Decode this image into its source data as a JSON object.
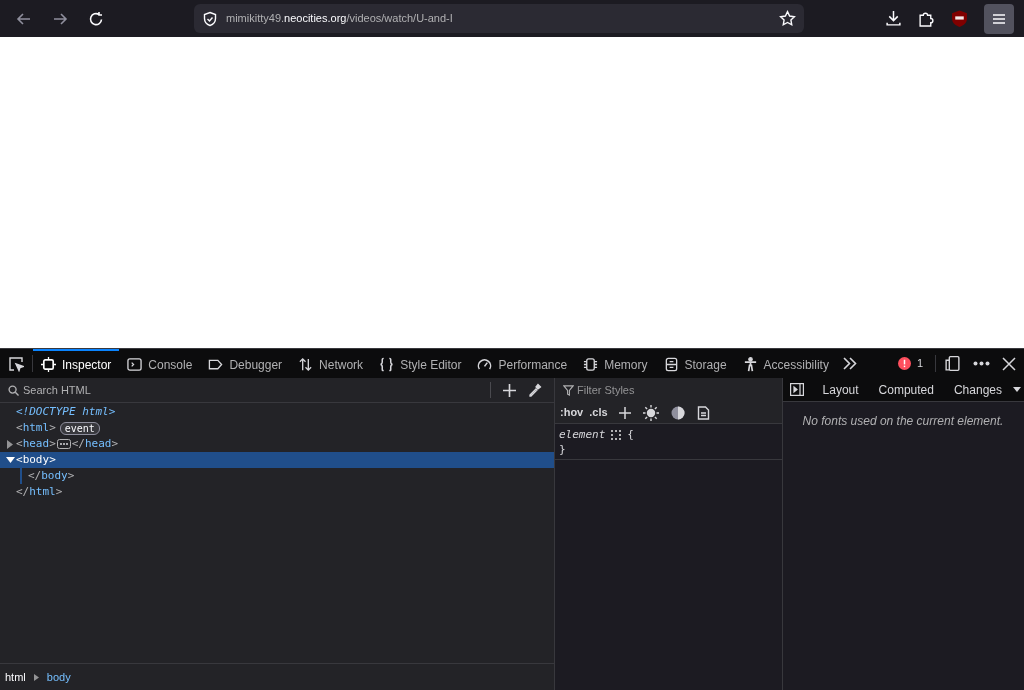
{
  "browser": {
    "url_parts": [
      {
        "kind": "sub",
        "text": "mimikitty49."
      },
      {
        "kind": "domain",
        "text": "neocities.org"
      },
      {
        "kind": "path",
        "text": "/videos/watch/U-and-I"
      }
    ]
  },
  "devtools": {
    "tabs": [
      {
        "kind": "inspector",
        "label": "Inspector",
        "selected": true
      },
      {
        "kind": "console",
        "label": "Console",
        "selected": false
      },
      {
        "kind": "debugger",
        "label": "Debugger",
        "selected": false
      },
      {
        "kind": "network",
        "label": "Network",
        "selected": false
      },
      {
        "kind": "style",
        "label": "Style Editor",
        "selected": false
      },
      {
        "kind": "performance",
        "label": "Performance",
        "selected": false
      },
      {
        "kind": "memory",
        "label": "Memory",
        "selected": false
      },
      {
        "kind": "storage",
        "label": "Storage",
        "selected": false
      },
      {
        "kind": "accessibility",
        "label": "Accessibility",
        "selected": false
      }
    ],
    "error_count": "1",
    "markup": {
      "search_placeholder": "Search HTML",
      "nodes": [
        {
          "kind": "doctype",
          "text": "<!DOCTYPE html>"
        },
        {
          "kind": "tag",
          "text": "<html>",
          "badge": "event"
        },
        {
          "kind": "tag",
          "text": "<head>",
          "closing": "</head>",
          "expanded": false,
          "selected": false
        },
        {
          "kind": "tag",
          "text": "<body>",
          "expanded": true,
          "selected": true,
          "children": [
            {
              "text": "</body>"
            }
          ]
        },
        {
          "kind": "tag",
          "text": "</html>"
        }
      ]
    },
    "rules": {
      "filter_placeholder": "Filter Styles",
      "toggles": [
        ":hov",
        ".cls"
      ],
      "selector": "element",
      "open_brace": "{",
      "close_brace": "}"
    },
    "sidebar": {
      "tabs": [
        "Layout",
        "Computed",
        "Changes"
      ],
      "message": "No fonts used on the current element."
    },
    "breadcrumbs": [
      {
        "label": "html",
        "selected": false
      },
      {
        "label": "body",
        "selected": true
      }
    ]
  }
}
